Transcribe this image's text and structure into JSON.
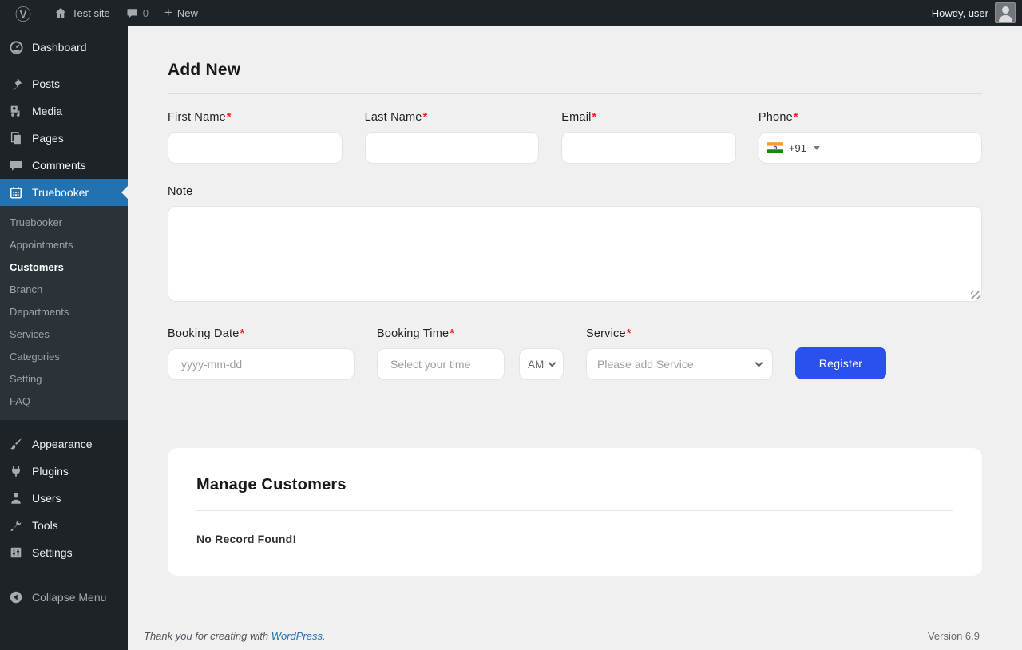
{
  "admin_bar": {
    "site_name": "Test site",
    "comments_count": "0",
    "new_label": "New",
    "howdy": "Howdy, user"
  },
  "sidebar": {
    "items": [
      {
        "label": "Dashboard"
      },
      {
        "label": "Posts"
      },
      {
        "label": "Media"
      },
      {
        "label": "Pages"
      },
      {
        "label": "Comments"
      },
      {
        "label": "Truebooker"
      },
      {
        "label": "Appearance"
      },
      {
        "label": "Plugins"
      },
      {
        "label": "Users"
      },
      {
        "label": "Tools"
      },
      {
        "label": "Settings"
      }
    ],
    "submenu": [
      "Truebooker",
      "Appointments",
      "Customers",
      "Branch",
      "Departments",
      "Services",
      "Categories",
      "Setting",
      "FAQ"
    ],
    "current_submenu": "Customers",
    "collapse_label": "Collapse Menu"
  },
  "form": {
    "title": "Add New",
    "fields": {
      "first_name": {
        "label": "First Name",
        "required": "*"
      },
      "last_name": {
        "label": "Last Name",
        "required": "*"
      },
      "email": {
        "label": "Email",
        "required": "*"
      },
      "phone": {
        "label": "Phone",
        "required": "*",
        "dial_code": "+91",
        "flag": "india-flag"
      }
    },
    "note_label": "Note",
    "booking_date": {
      "label": "Booking Date",
      "required": "*",
      "placeholder": "yyyy-mm-dd"
    },
    "booking_time": {
      "label": "Booking Time",
      "required": "*",
      "placeholder": "Select your time",
      "meridiem": "AM"
    },
    "service": {
      "label": "Service",
      "required": "*",
      "value": "Please add Service"
    },
    "register_label": "Register"
  },
  "manage": {
    "title": "Manage Customers",
    "empty_message": "No Record Found!"
  },
  "footer": {
    "thanks_prefix": "Thank you for creating with",
    "link_label": "WordPress",
    "period": ".",
    "version": "Version 6.9"
  },
  "colors": {
    "accent_blue": "#2b50ed",
    "wp_admin_blue": "#2271b1",
    "required_red": "#ef2222",
    "dark_bg": "#1d2327",
    "submenu_bg": "#2c3338",
    "content_bg": "#f0f0f1"
  }
}
